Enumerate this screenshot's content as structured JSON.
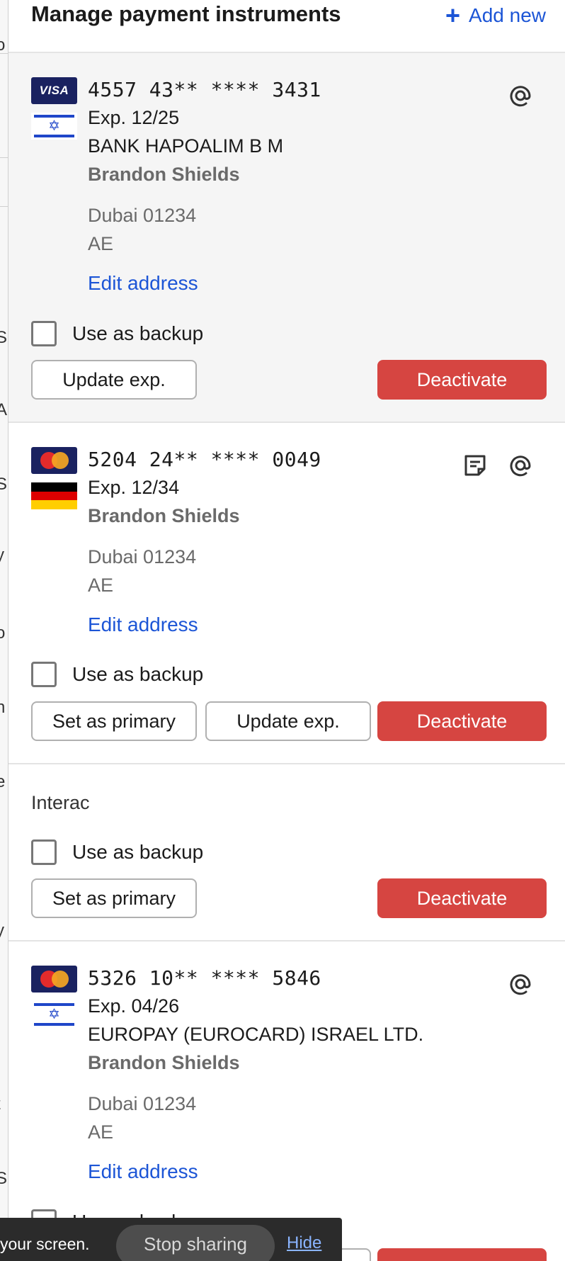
{
  "header": {
    "title": "Manage payment instruments",
    "add_new_label": "Add new"
  },
  "instruments": [
    {
      "brand_icon": "visa-logo",
      "brand_label": "VISA",
      "country_flag": "israel-flag",
      "number": "4557 43** **** 3431",
      "expiry": "Exp. 12/25",
      "bank": "BANK HAPOALIM B M",
      "holder": "Brandon Shields",
      "city_zip": "Dubai 01234",
      "country": "AE",
      "edit_address_label": "Edit address",
      "backup_label": "Use as backup",
      "backup_checked": false,
      "update_exp_label": "Update exp.",
      "deactivate_label": "Deactivate",
      "icons": [
        "at-sign-icon"
      ]
    },
    {
      "brand_icon": "mastercard-logo",
      "brand_label": "MasterCard",
      "country_flag": "germany-flag",
      "number": "5204 24** **** 0049",
      "expiry": "Exp. 12/34",
      "holder": "Brandon Shields",
      "city_zip": "Dubai 01234",
      "country": "AE",
      "edit_address_label": "Edit address",
      "backup_label": "Use as backup",
      "backup_checked": false,
      "set_primary_label": "Set as primary",
      "update_exp_label": "Update exp.",
      "deactivate_label": "Deactivate",
      "icons": [
        "note-icon",
        "at-sign-icon"
      ]
    },
    {
      "name": "Interac",
      "backup_label": "Use as backup",
      "backup_checked": false,
      "set_primary_label": "Set as primary",
      "deactivate_label": "Deactivate"
    },
    {
      "brand_icon": "mastercard-logo",
      "brand_label": "MasterCard",
      "country_flag": "israel-flag",
      "number": "5326 10** **** 5846",
      "expiry": "Exp. 04/26",
      "bank": "EUROPAY (EUROCARD) ISRAEL LTD.",
      "holder": "Brandon Shields",
      "city_zip": "Dubai 01234",
      "country": "AE",
      "edit_address_label": "Edit address",
      "backup_label": "Use as backup",
      "icons": [
        "at-sign-icon"
      ]
    }
  ],
  "screen_share": {
    "message": "your screen.",
    "stop_label": "Stop sharing",
    "hide_label": "Hide"
  },
  "colors": {
    "accent_blue": "#1c55d6",
    "danger_red": "#d64541",
    "card_navy": "#1a2260"
  }
}
